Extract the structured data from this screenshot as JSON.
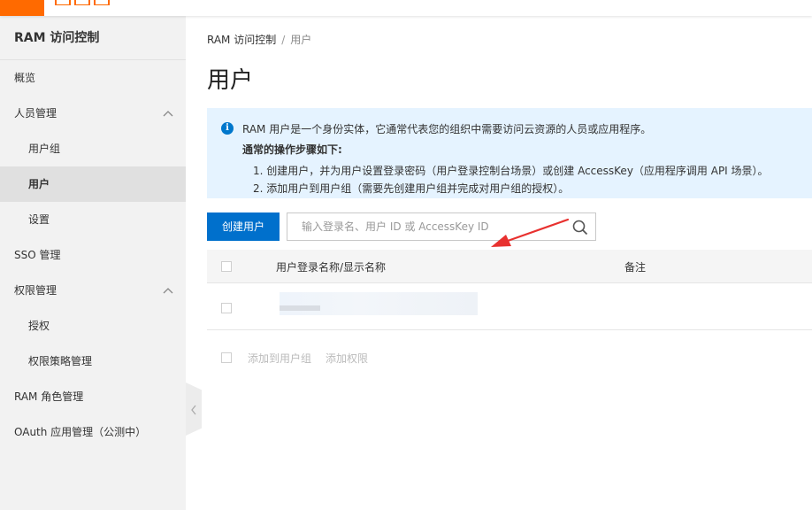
{
  "sidebar": {
    "title": "RAM 访问控制",
    "items": [
      {
        "label": "概览"
      },
      {
        "label": "人员管理"
      },
      {
        "label": "用户组"
      },
      {
        "label": "用户"
      },
      {
        "label": "设置"
      },
      {
        "label": "SSO 管理"
      },
      {
        "label": "权限管理"
      },
      {
        "label": "授权"
      },
      {
        "label": "权限策略管理"
      },
      {
        "label": "RAM 角色管理"
      },
      {
        "label": "OAuth 应用管理（公测中）"
      }
    ]
  },
  "breadcrumb": {
    "root": "RAM 访问控制",
    "separator": "/",
    "current": "用户"
  },
  "page_title": "用户",
  "notice": {
    "text": "RAM 用户是一个身份实体，它通常代表您的组织中需要访问云资源的人员或应用程序。",
    "steps_title": "通常的操作步骤如下:",
    "step1": "1. 创建用户，并为用户设置登录密码（用户登录控制台场景）或创建 AccessKey（应用程序调用 API 场景）。",
    "step2": "2. 添加用户到用户组（需要先创建用户组并完成对用户组的授权）。"
  },
  "toolbar": {
    "create_label": "创建用户",
    "search_placeholder": "输入登录名、用户 ID 或 AccessKey ID"
  },
  "table": {
    "columns": [
      "用户登录名称/显示名称",
      "备注"
    ]
  },
  "footer": {
    "add_to_group": "添加到用户组",
    "add_permission": "添加权限"
  },
  "colors": {
    "brand": "#ff6a00",
    "primary": "#0070cc",
    "notice_bg": "#e5f3ff",
    "arrow": "#e8312f"
  }
}
